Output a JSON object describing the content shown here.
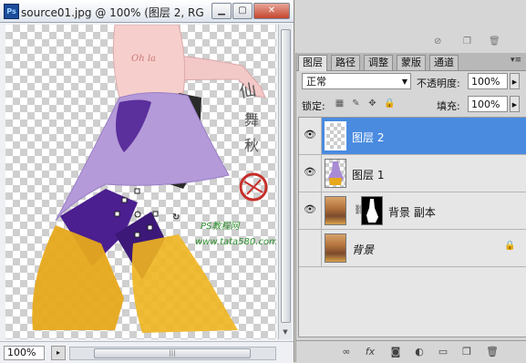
{
  "document": {
    "app_icon": "Ps",
    "title": "source01.jpg @ 100% (图层 2, RG...",
    "zoom": "100%",
    "watermark_site": "www.tata580.com",
    "watermark_brand": "PS教程网"
  },
  "layers_panel": {
    "tabs": [
      "图层",
      "路径",
      "调整",
      "蒙版",
      "通道"
    ],
    "active_tab": "图层",
    "blend_mode": "正常",
    "opacity_label": "不透明度:",
    "opacity_value": "100%",
    "lock_label": "锁定:",
    "fill_label": "填充:",
    "fill_value": "100%",
    "layers": [
      {
        "name": "图层 2",
        "visible": true,
        "selected": true,
        "thumbnail": "transparent"
      },
      {
        "name": "图层 1",
        "visible": true,
        "selected": false,
        "thumbnail": "figure"
      },
      {
        "name": "背景 副本",
        "visible": true,
        "selected": false,
        "thumbnail": "photo",
        "has_mask": true
      },
      {
        "name": "背景",
        "visible": false,
        "selected": false,
        "thumbnail": "photo",
        "locked": true
      }
    ],
    "bottom_icons": [
      "link-layers-icon",
      "fx-icon",
      "add-mask-icon",
      "adjustment-layer-icon",
      "new-group-icon",
      "new-layer-icon",
      "delete-icon"
    ]
  }
}
